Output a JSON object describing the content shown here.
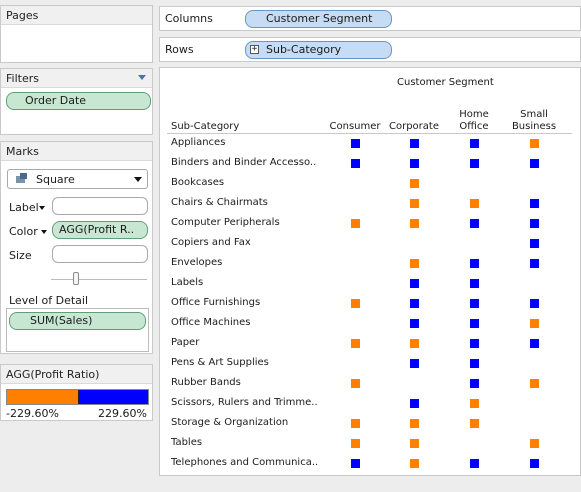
{
  "pages": {
    "title": "Pages"
  },
  "filters": {
    "title": "Filters",
    "pills": [
      "Order Date"
    ]
  },
  "marks": {
    "title": "Marks",
    "mark_type": "Square",
    "label_label": "Label",
    "color_label": "Color",
    "color_pill": "AGG(Profit R..",
    "size_label": "Size",
    "lod_label": "Level of Detail",
    "lod_pill": "SUM(Sales)"
  },
  "legend": {
    "title": "AGG(Profit Ratio)",
    "min_label": "-229.60%",
    "max_label": "229.60%",
    "neg_color": "#ff7f00",
    "pos_color": "#0000ff",
    "zero_position": 0.5
  },
  "shelves": {
    "columns_label": "Columns",
    "columns_pill": "Customer Segment",
    "rows_label": "Rows",
    "rows_pill": "Sub-Category",
    "rows_expand": "+"
  },
  "view": {
    "column_header": "Customer Segment",
    "row_header": "Sub-Category",
    "segments": [
      {
        "line1": "",
        "line2": "Consumer"
      },
      {
        "line1": "",
        "line2": "Corporate"
      },
      {
        "line1": "Home",
        "line2": "Office"
      },
      {
        "line1": "Small",
        "line2": "Business"
      }
    ],
    "rows": [
      {
        "name": "Appliances",
        "marks": [
          "blue",
          "blue",
          "blue",
          "orange"
        ]
      },
      {
        "name": "Binders and Binder Accesso..",
        "marks": [
          "blue",
          "blue",
          "blue",
          "blue"
        ]
      },
      {
        "name": "Bookcases",
        "marks": [
          null,
          "orange",
          null,
          null
        ]
      },
      {
        "name": "Chairs & Chairmats",
        "marks": [
          null,
          "orange",
          "orange",
          "blue"
        ]
      },
      {
        "name": "Computer Peripherals",
        "marks": [
          "orange",
          "orange",
          "blue",
          "blue"
        ]
      },
      {
        "name": "Copiers and Fax",
        "marks": [
          null,
          null,
          null,
          "blue"
        ]
      },
      {
        "name": "Envelopes",
        "marks": [
          null,
          "orange",
          "blue",
          "blue"
        ]
      },
      {
        "name": "Labels",
        "marks": [
          null,
          "blue",
          "blue",
          null
        ]
      },
      {
        "name": "Office Furnishings",
        "marks": [
          "orange",
          "blue",
          "blue",
          "blue"
        ]
      },
      {
        "name": "Office Machines",
        "marks": [
          null,
          "blue",
          "blue",
          "orange"
        ]
      },
      {
        "name": "Paper",
        "marks": [
          "orange",
          "orange",
          "blue",
          "blue"
        ]
      },
      {
        "name": "Pens & Art Supplies",
        "marks": [
          null,
          "blue",
          "blue",
          null
        ]
      },
      {
        "name": "Rubber Bands",
        "marks": [
          "orange",
          null,
          "blue",
          "orange"
        ]
      },
      {
        "name": "Scissors, Rulers and Trimme..",
        "marks": [
          null,
          "blue",
          "orange",
          null
        ]
      },
      {
        "name": "Storage & Organization",
        "marks": [
          "orange",
          "orange",
          "orange",
          null
        ]
      },
      {
        "name": "Tables",
        "marks": [
          "orange",
          "orange",
          null,
          "orange"
        ]
      },
      {
        "name": "Telephones and Communica..",
        "marks": [
          "blue",
          "orange",
          "blue",
          "blue"
        ]
      }
    ]
  }
}
